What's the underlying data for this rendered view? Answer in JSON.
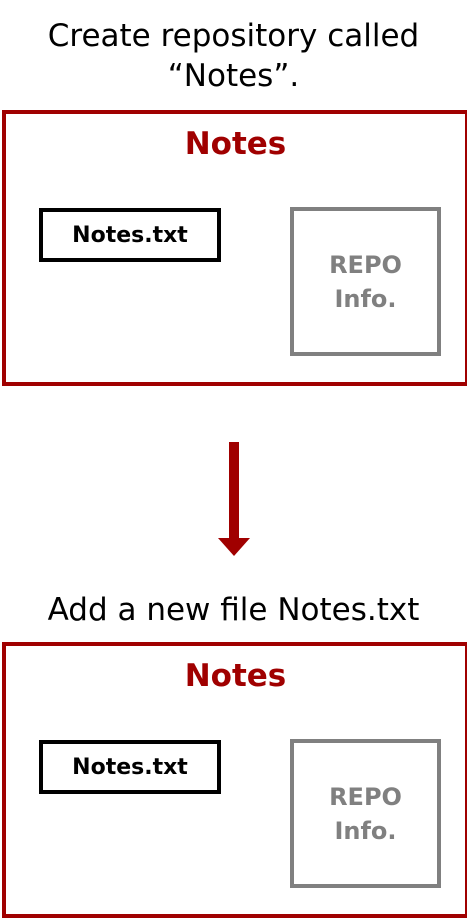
{
  "colors": {
    "repo_border": "#a00000",
    "file_border": "#000000",
    "info_border": "#808080",
    "arrow": "#a00000"
  },
  "step1": {
    "caption_line1": "Create repository called",
    "caption_line2": "“Notes”.",
    "repo_title": "Notes",
    "file_label": "Notes.txt",
    "info_line1": "REPO",
    "info_line2": "Info."
  },
  "arrow": {
    "icon": "down-arrow-icon"
  },
  "step2": {
    "caption": "Add a new file Notes.txt",
    "repo_title": "Notes",
    "file_label": "Notes.txt",
    "info_line1": "REPO",
    "info_line2": "Info."
  }
}
